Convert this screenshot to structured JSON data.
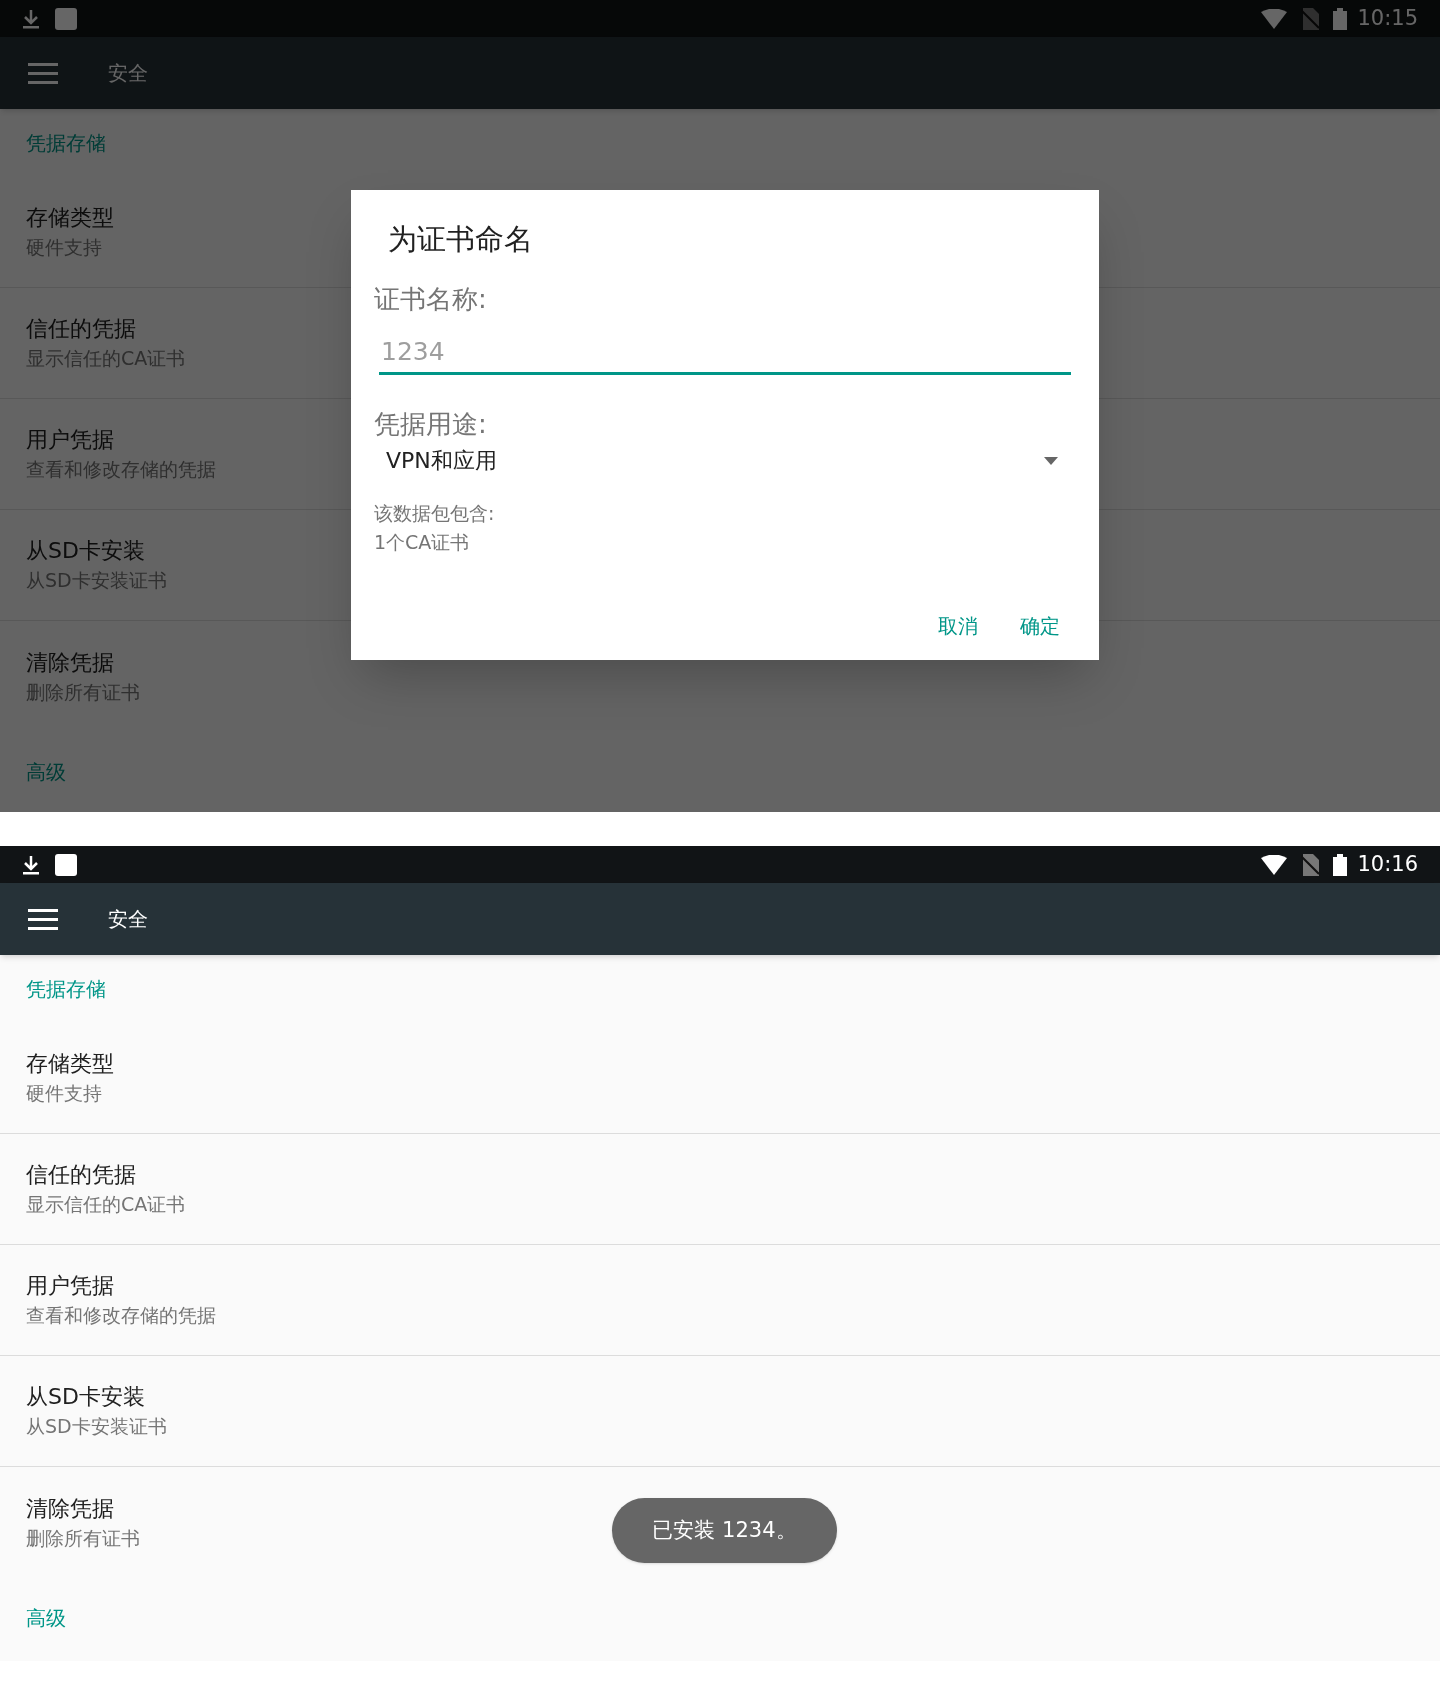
{
  "screens": [
    {
      "status_bar": {
        "time": "10:15"
      },
      "toolbar": {
        "title": "安全"
      },
      "items": [
        {
          "kind": "header",
          "title": "凭据存储"
        },
        {
          "kind": "row",
          "title": "存储类型",
          "subtitle": "硬件支持"
        },
        {
          "kind": "row",
          "title": "信任的凭据",
          "subtitle": "显示信任的CA证书"
        },
        {
          "kind": "row",
          "title": "用户凭据",
          "subtitle": "查看和修改存储的凭据"
        },
        {
          "kind": "row",
          "title": "从SD卡安装",
          "subtitle": "从SD卡安装证书"
        },
        {
          "kind": "row",
          "title": "清除凭据",
          "subtitle": "删除所有证书"
        },
        {
          "kind": "header",
          "title": "高级"
        }
      ],
      "dialog": {
        "title": "为证书命名",
        "name_label": "证书名称:",
        "name_value": "1234",
        "usage_label": "凭据用途:",
        "usage_value": "VPN和应用",
        "info_lines": [
          "该数据包包含:",
          "1个CA证书"
        ],
        "buttons": [
          "取消",
          "确定"
        ]
      }
    },
    {
      "status_bar": {
        "time": "10:16"
      },
      "toolbar": {
        "title": "安全"
      },
      "items": [
        {
          "kind": "header",
          "title": "凭据存储"
        },
        {
          "kind": "row",
          "title": "存储类型",
          "subtitle": "硬件支持"
        },
        {
          "kind": "row",
          "title": "信任的凭据",
          "subtitle": "显示信任的CA证书"
        },
        {
          "kind": "row",
          "title": "用户凭据",
          "subtitle": "查看和修改存储的凭据"
        },
        {
          "kind": "row",
          "title": "从SD卡安装",
          "subtitle": "从SD卡安装证书"
        },
        {
          "kind": "row",
          "title": "清除凭据",
          "subtitle": "删除所有证书"
        },
        {
          "kind": "header",
          "title": "高级"
        }
      ],
      "toast": "已安装 1234。"
    }
  ]
}
